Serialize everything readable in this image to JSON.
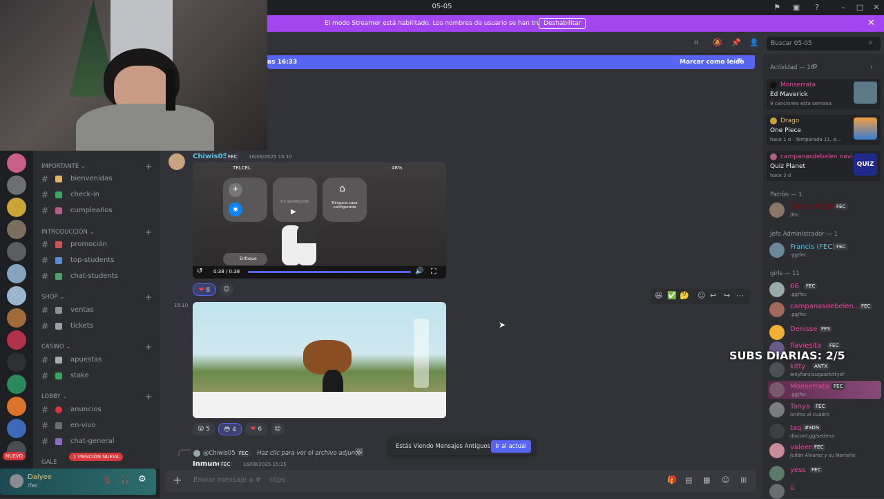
{
  "window": {
    "title": "05-05"
  },
  "streamer_banner": {
    "text": "El modo Streamer está habilitado. Los nombres de usuario se han truncado.",
    "button": "Deshabilitar"
  },
  "search": {
    "placeholder": "Buscar 05-05"
  },
  "new_messages": {
    "time": "as 16:33",
    "mark_read": "Marcar como leído"
  },
  "sidebar": {
    "categories": [
      {
        "label": "IMPORTANTE",
        "channels": [
          "bienvenidas",
          "check-in",
          "cumpleaños"
        ]
      },
      {
        "label": "INTRODUCCIÓN",
        "channels": [
          "promoción",
          "top-students",
          "chat-students"
        ]
      },
      {
        "label": "SHOP",
        "channels": [
          "ventas",
          "tickets"
        ]
      },
      {
        "label": "CASINO",
        "channels": [
          "apuestas",
          "stake"
        ]
      },
      {
        "label": "LOBBY",
        "channels": [
          "anuncios",
          "en-vivo",
          "chat-general"
        ]
      },
      {
        "label": "GALE"
      }
    ],
    "badge_new": "NUEVO",
    "badge_mention": "1 MENCIÓN NUEVA"
  },
  "user": {
    "name": "Dalyee",
    "status": "/fec"
  },
  "messages": {
    "m1": {
      "author": "Chiwis05",
      "tag": "FEC",
      "time": "16/08/2025 15:10",
      "carrier": "TELCEL",
      "battery": "48%",
      "home_tile": "Ninguna casa configurada",
      "playback": "Sin reproducción",
      "focus": "Enfoque",
      "video_time": "0:38 / 0:38"
    },
    "r1": {
      "count": "8"
    },
    "m2_time": "15:10",
    "reactions2": {
      "a": "5",
      "b": "4",
      "c": "6"
    },
    "reply": {
      "author": "@Chiwis05",
      "tag": "FEC",
      "text": "Haz clic para ver el archivo adjunto"
    },
    "m3": {
      "author": "Inmune",
      "tag": "FEC",
      "time": "16/08/2025 15:25"
    }
  },
  "old_toast": {
    "text": "Estás Viendo Mensajes Antiguos",
    "button": "Ir al actual"
  },
  "composer": {
    "placeholder": "Enviar mensaje a #",
    "channel_part": "clips"
  },
  "overlay": {
    "subs": "SUBS DIARIAS: 2/5"
  },
  "activity": {
    "header": "Actividad — 16",
    "items": [
      {
        "name": "Monserrata",
        "game": "Ed Maverick",
        "sub": "9 canciones esta semana"
      },
      {
        "name": "Drago",
        "game": "One Piece",
        "sub": "hace 1 d · Temporada 11, e..."
      },
      {
        "name": "campanasdebelen navi...",
        "game": "Quiz Planet",
        "sub": "hace 3 d"
      }
    ],
    "quiz": "QUIZ"
  },
  "sections": {
    "patron": "Patrón — 1",
    "jefe": "Jefe Administrador — 1",
    "girls": "girls — 11"
  },
  "members": [
    {
      "name": "Chiriso Flight",
      "tag": "FEC",
      "sub": "/fec"
    },
    {
      "name": "Francis (FEC)",
      "tag": "FEC",
      "sub": "·gg/fec"
    },
    {
      "name": "66",
      "tag": "FEC",
      "sub": ".gg/fec"
    },
    {
      "name": "campanasdebelen...",
      "tag": "FEC",
      "sub": ".gg/fec"
    },
    {
      "name": "Denisse",
      "tag": "FES",
      "sub": ""
    },
    {
      "name": "flaviesita",
      "tag": "FEC",
      "sub": ""
    },
    {
      "name": "kitty",
      "tag": "ANTX",
      "sub": "onlyfans/sugaarkittyof"
    },
    {
      "name": "Monserrata",
      "tag": "FEC",
      "sub": ".gg/fec"
    },
    {
      "name": "Tanya",
      "tag": "FEC",
      "sub": "Animo al cuadro"
    },
    {
      "name": "taq",
      "tag": "#SDN",
      "sub": "discord.gg/sedena"
    },
    {
      "name": "valeen",
      "tag": "FEC",
      "sub": "Julión Álvarez y su Norteño"
    },
    {
      "name": "yess",
      "tag": "FEC",
      "sub": ""
    },
    {
      "name": "ü",
      "tag": "",
      "sub": ""
    }
  ],
  "colors": {
    "blurple": "#5865f2",
    "streamer": "#a146f0",
    "pink": "#eb459f"
  }
}
